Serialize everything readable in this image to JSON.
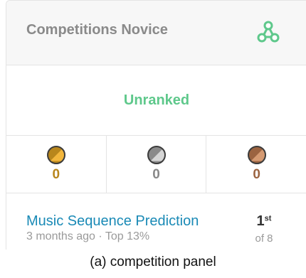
{
  "panel": {
    "title": "Competitions Novice",
    "tier_icon": "competitions-icon",
    "rank_status": "Unranked",
    "accent_color": "#5ec88b"
  },
  "medals": [
    {
      "name": "gold",
      "count": "0",
      "color": "#b8861c"
    },
    {
      "name": "silver",
      "count": "0",
      "color": "#888888"
    },
    {
      "name": "bronze",
      "count": "0",
      "color": "#9b6340"
    }
  ],
  "competition": {
    "title": "Music Sequence Prediction",
    "meta": "3 months ago · Top 13%",
    "rank": "1",
    "rank_suffix": "st",
    "of": "of 8"
  },
  "caption": "(a) competition panel"
}
